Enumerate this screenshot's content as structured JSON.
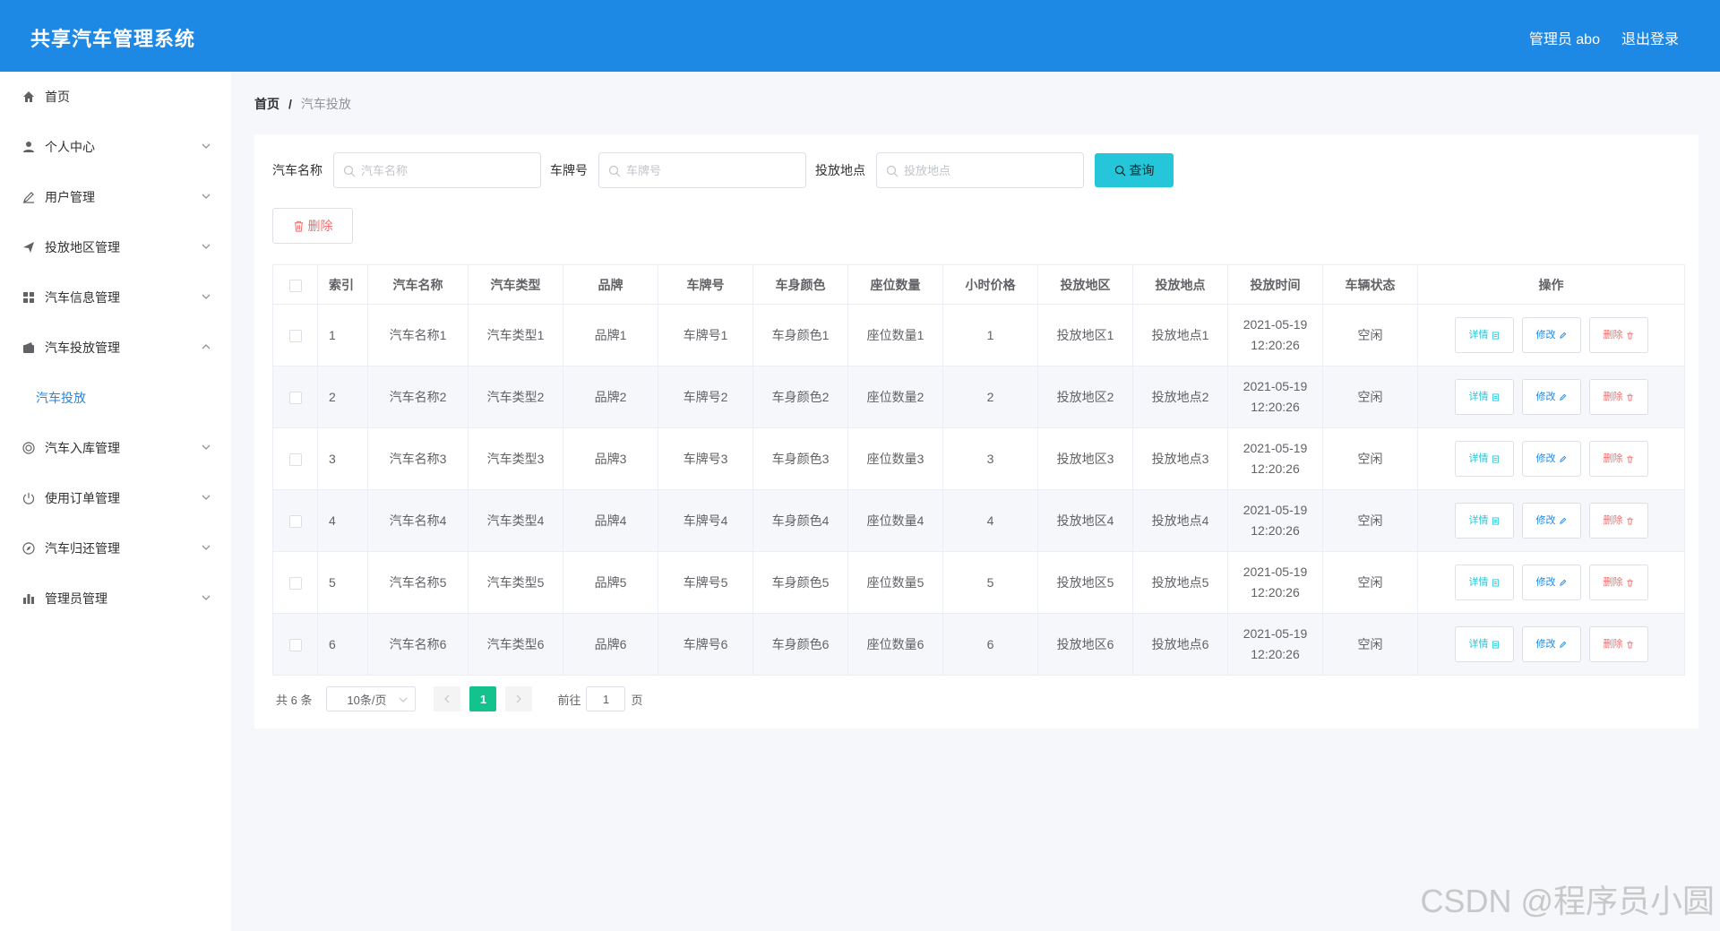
{
  "app": {
    "title": "共享汽车管理系统"
  },
  "header": {
    "user_label": "管理员 abo",
    "logout_label": "退出登录"
  },
  "sidebar": {
    "items": [
      {
        "label": "首页",
        "icon": "home-icon",
        "expandable": false
      },
      {
        "label": "个人中心",
        "icon": "user-icon",
        "expandable": true
      },
      {
        "label": "用户管理",
        "icon": "pen-icon",
        "expandable": true
      },
      {
        "label": "投放地区管理",
        "icon": "send-icon",
        "expandable": true
      },
      {
        "label": "汽车信息管理",
        "icon": "grid-icon",
        "expandable": true
      },
      {
        "label": "汽车投放管理",
        "icon": "wallet-icon",
        "expandable": true,
        "expanded": true
      },
      {
        "label": "汽车入库管理",
        "icon": "target-icon",
        "expandable": true
      },
      {
        "label": "使用订单管理",
        "icon": "power-icon",
        "expandable": true
      },
      {
        "label": "汽车归还管理",
        "icon": "compass-icon",
        "expandable": true
      },
      {
        "label": "管理员管理",
        "icon": "bar-chart-icon",
        "expandable": true
      }
    ],
    "active_sub": "汽车投放"
  },
  "breadcrumb": {
    "home": "首页",
    "separator": "/",
    "current": "汽车投放"
  },
  "search": {
    "fields": [
      {
        "label": "汽车名称",
        "placeholder": "汽车名称"
      },
      {
        "label": "车牌号",
        "placeholder": "车牌号"
      },
      {
        "label": "投放地点",
        "placeholder": "投放地点"
      }
    ],
    "query_label": "查询"
  },
  "toolbar": {
    "delete_label": "删除"
  },
  "table": {
    "columns": [
      "索引",
      "汽车名称",
      "汽车类型",
      "品牌",
      "车牌号",
      "车身颜色",
      "座位数量",
      "小时价格",
      "投放地区",
      "投放地点",
      "投放时间",
      "车辆状态",
      "操作"
    ],
    "rows": [
      {
        "idx": "1",
        "name": "汽车名称1",
        "type": "汽车类型1",
        "brand": "品牌1",
        "plate": "车牌号1",
        "color": "车身颜色1",
        "seats": "座位数量1",
        "price": "1",
        "region": "投放地区1",
        "spot": "投放地点1",
        "date": "2021-05-19",
        "time": "12:20:26",
        "status": "空闲"
      },
      {
        "idx": "2",
        "name": "汽车名称2",
        "type": "汽车类型2",
        "brand": "品牌2",
        "plate": "车牌号2",
        "color": "车身颜色2",
        "seats": "座位数量2",
        "price": "2",
        "region": "投放地区2",
        "spot": "投放地点2",
        "date": "2021-05-19",
        "time": "12:20:26",
        "status": "空闲"
      },
      {
        "idx": "3",
        "name": "汽车名称3",
        "type": "汽车类型3",
        "brand": "品牌3",
        "plate": "车牌号3",
        "color": "车身颜色3",
        "seats": "座位数量3",
        "price": "3",
        "region": "投放地区3",
        "spot": "投放地点3",
        "date": "2021-05-19",
        "time": "12:20:26",
        "status": "空闲"
      },
      {
        "idx": "4",
        "name": "汽车名称4",
        "type": "汽车类型4",
        "brand": "品牌4",
        "plate": "车牌号4",
        "color": "车身颜色4",
        "seats": "座位数量4",
        "price": "4",
        "region": "投放地区4",
        "spot": "投放地点4",
        "date": "2021-05-19",
        "time": "12:20:26",
        "status": "空闲"
      },
      {
        "idx": "5",
        "name": "汽车名称5",
        "type": "汽车类型5",
        "brand": "品牌5",
        "plate": "车牌号5",
        "color": "车身颜色5",
        "seats": "座位数量5",
        "price": "5",
        "region": "投放地区5",
        "spot": "投放地点5",
        "date": "2021-05-19",
        "time": "12:20:26",
        "status": "空闲"
      },
      {
        "idx": "6",
        "name": "汽车名称6",
        "type": "汽车类型6",
        "brand": "品牌6",
        "plate": "车牌号6",
        "color": "车身颜色6",
        "seats": "座位数量6",
        "price": "6",
        "region": "投放地区6",
        "spot": "投放地点6",
        "date": "2021-05-19",
        "time": "12:20:26",
        "status": "空闲"
      }
    ],
    "actions": {
      "detail": "详情",
      "edit": "修改",
      "delete": "删除"
    }
  },
  "pagination": {
    "total": "共 6 条",
    "page_size": "10条/页",
    "current_page": "1",
    "goto_prefix": "前往",
    "goto_value": "1",
    "goto_suffix": "页"
  },
  "watermark": "CSDN @程序员小圆",
  "colors": {
    "header": "#1e88e5",
    "accent": "#26c6da",
    "danger": "#f56c6c",
    "page_active": "#13c28d"
  }
}
